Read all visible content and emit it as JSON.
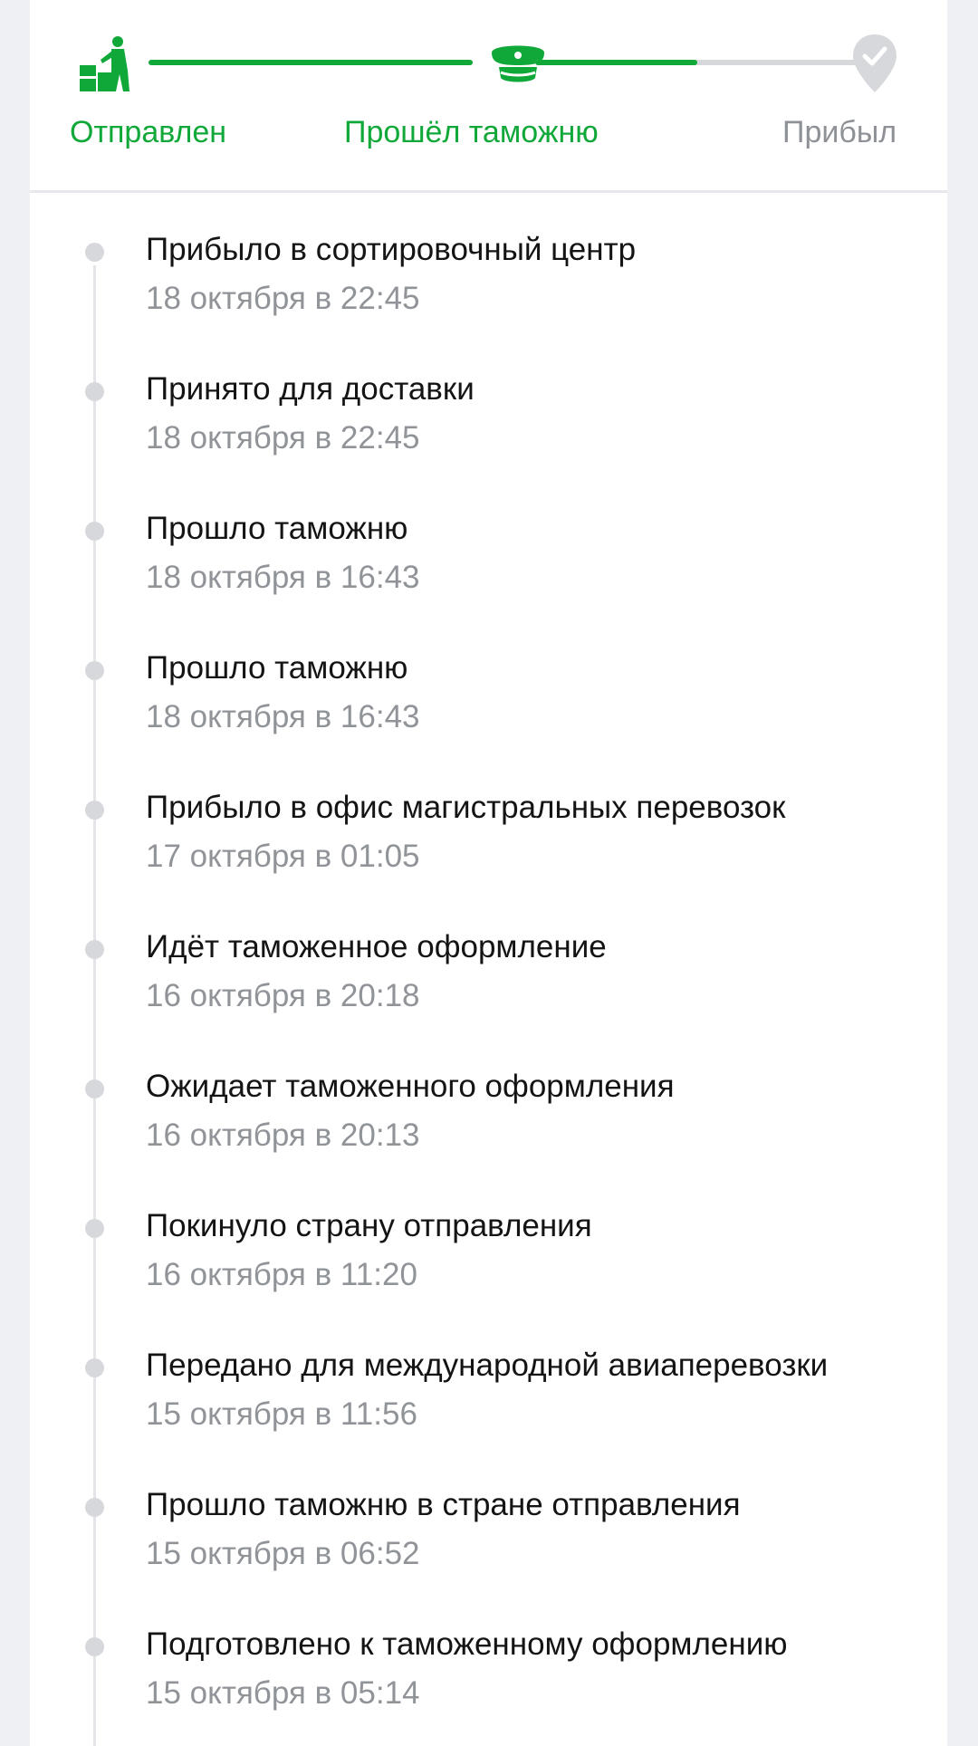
{
  "colors": {
    "accent": "#11a83a",
    "inactive": "#d6d8dc",
    "muted_text": "#909398"
  },
  "progress": {
    "steps": [
      {
        "label": "Отправлен",
        "icon": "shipped-worker-icon",
        "state": "done"
      },
      {
        "label": "Прошёл таможню",
        "icon": "customs-cap-icon",
        "state": "done"
      },
      {
        "label": "Прибыл",
        "icon": "location-check-icon",
        "state": "todo"
      }
    ],
    "segment2_fill": 0.5
  },
  "events": [
    {
      "title": "Прибыло в сортировочный центр",
      "time": "18 октября в 22:45"
    },
    {
      "title": "Принято для доставки",
      "time": "18 октября в 22:45"
    },
    {
      "title": "Прошло таможню",
      "time": "18 октября в 16:43"
    },
    {
      "title": "Прошло таможню",
      "time": "18 октября в 16:43"
    },
    {
      "title": "Прибыло в офис магистральных перевозок",
      "time": "17 октября в 01:05"
    },
    {
      "title": "Идёт таможенное оформление",
      "time": "16 октября в 20:18"
    },
    {
      "title": "Ожидает таможенного оформления",
      "time": "16 октября в 20:13"
    },
    {
      "title": "Покинуло страну отправления",
      "time": "16 октября в 11:20"
    },
    {
      "title": "Передано для международной авиаперевозки",
      "time": "15 октября в 11:56"
    },
    {
      "title": "Прошло таможню в стране отправления",
      "time": "15 октября в 06:52"
    },
    {
      "title": "Подготовлено к таможенному оформлению",
      "time": "15 октября в 05:14"
    }
  ]
}
